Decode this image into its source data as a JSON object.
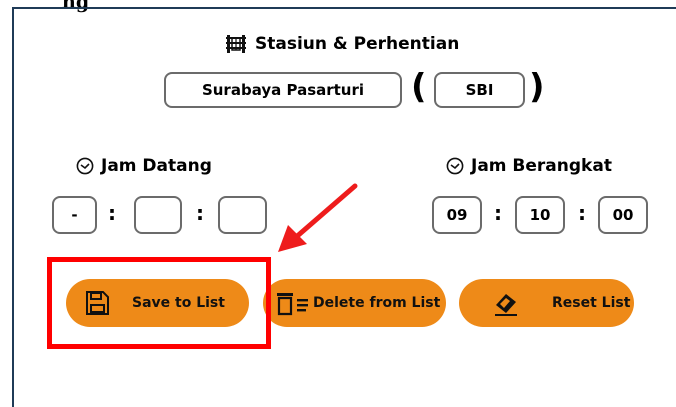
{
  "top_clip_text": "ng",
  "station_section": {
    "title": "Stasiun & Perhentian",
    "station_name": "Surabaya Pasarturi",
    "open_paren": "(",
    "station_code": "SBI",
    "close_paren": ")"
  },
  "arrival": {
    "label": "Jam Datang",
    "hour": "-",
    "minute": "",
    "second": ""
  },
  "departure": {
    "label": "Jam Berangkat",
    "hour": "09",
    "minute": "10",
    "second": "00"
  },
  "separator": ":",
  "buttons": {
    "save": "Save to List",
    "delete": "Delete from List",
    "reset": "Reset List"
  },
  "colors": {
    "button": "#ee8a18",
    "highlight": "#ff0000",
    "panel_border": "#1f3b57"
  },
  "icons": [
    "station-icon",
    "clock-icon",
    "floppy-disk-icon",
    "trash-list-icon",
    "eraser-icon"
  ]
}
